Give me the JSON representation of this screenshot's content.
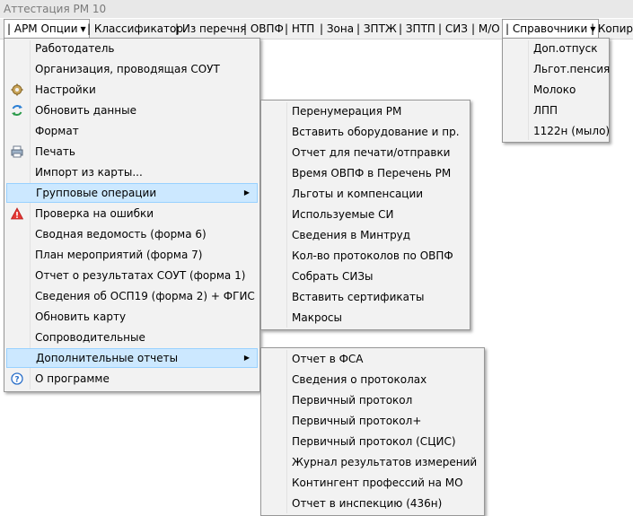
{
  "window": {
    "title": "Аттестация РМ 10"
  },
  "menubar": {
    "items": [
      {
        "label": "АРМ Опции",
        "prefix": "| ",
        "dropdown": true
      },
      {
        "label": "Классификатор",
        "prefix": "| "
      },
      {
        "label": "Из перечня",
        "prefix": "| "
      },
      {
        "label": "ОВПФ",
        "prefix": "| "
      },
      {
        "label": "НТП",
        "prefix": "| "
      },
      {
        "label": "Зона",
        "prefix": "| "
      },
      {
        "label": "ЗПТЖ",
        "prefix": "| "
      },
      {
        "label": "ЗПТП",
        "prefix": "| "
      },
      {
        "label": "СИЗ",
        "prefix": "| "
      },
      {
        "label": "М/О",
        "prefix": "| "
      },
      {
        "label": "Справочники",
        "prefix": "| ",
        "dropdown": true
      },
      {
        "label": "Копиро",
        "prefix": "| "
      }
    ]
  },
  "arm_menu": {
    "items": [
      {
        "label": "Работодатель",
        "icon": ""
      },
      {
        "label": "Организация, проводящая СОУТ",
        "icon": ""
      },
      {
        "label": "Настройки",
        "icon": "gear-icon"
      },
      {
        "label": "Обновить данные",
        "icon": "refresh-icon"
      },
      {
        "label": "Формат",
        "icon": ""
      },
      {
        "label": "Печать",
        "icon": "printer-icon"
      },
      {
        "label": "Импорт из карты...",
        "icon": ""
      },
      {
        "label": "Групповые операции",
        "icon": "",
        "submenu": true,
        "highlighted": true
      },
      {
        "label": "Проверка на ошибки",
        "icon": "warning-icon"
      },
      {
        "label": "Сводная ведомость (форма 6)",
        "icon": ""
      },
      {
        "label": "План мероприятий (форма 7)",
        "icon": ""
      },
      {
        "label": "Отчет о результатах СОУТ (форма 1)",
        "icon": ""
      },
      {
        "label": "Сведения об ОСП19 (форма 2) + ФГИС",
        "icon": ""
      },
      {
        "label": "Обновить карту",
        "icon": ""
      },
      {
        "label": "Сопроводительные",
        "icon": ""
      },
      {
        "label": "Дополнительные отчеты",
        "icon": "",
        "submenu": true,
        "highlighted": true
      },
      {
        "label": "О программе",
        "icon": "help-icon"
      }
    ]
  },
  "group_ops_menu": {
    "items": [
      "Перенумерация РМ",
      "Вставить оборудование и пр.",
      "Отчет для печати/отправки",
      "Время ОВПФ в Перечень РМ",
      "Льготы и компенсации",
      "Используемые СИ",
      "Сведения в Минтруд",
      "Кол-во протоколов по ОВПФ",
      "Собрать СИЗы",
      "Вставить сертификаты",
      "Макросы"
    ]
  },
  "extra_reports_menu": {
    "items": [
      "Отчет в ФСА",
      "Сведения о протоколах",
      "Первичный протокол",
      "Первичный протокол+",
      "Первичный протокол (СЦИС)",
      "Журнал результатов измерений",
      "Контингент профессий на МО",
      "Отчет в инспекцию (436н)"
    ]
  },
  "references_menu": {
    "items": [
      "Доп.отпуск",
      "Льгот.пенсия",
      "Молоко",
      "ЛПП",
      "1122н (мыло)"
    ]
  },
  "colors": {
    "highlight": "#cce8ff",
    "highlight_border": "#99d1ff",
    "menu_bg": "#f2f2f2"
  }
}
